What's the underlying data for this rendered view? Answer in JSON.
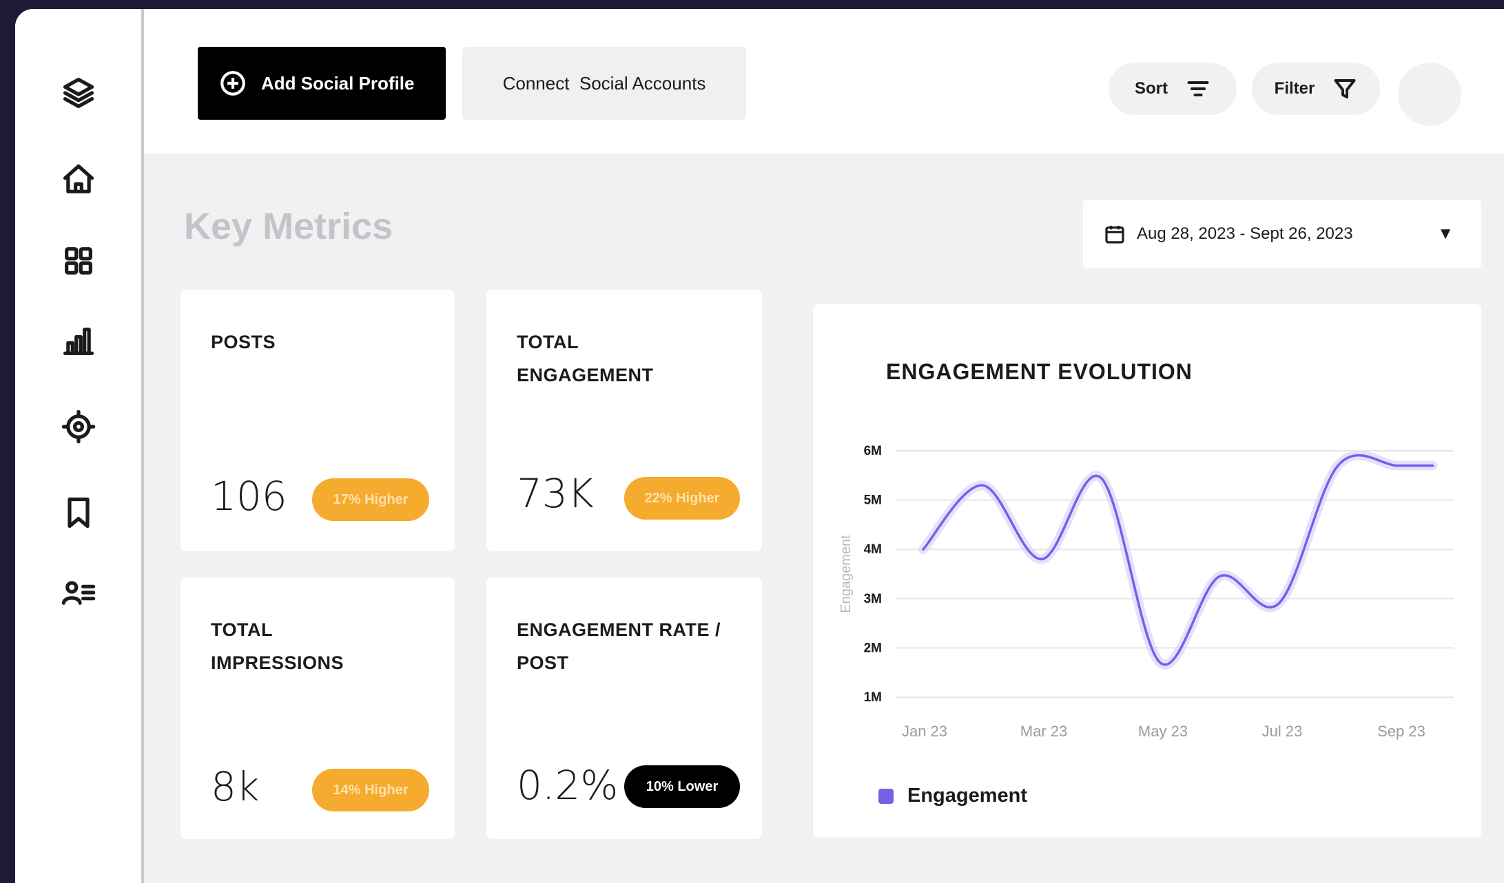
{
  "toolbar": {
    "add_profile_label": "Add Social Profile",
    "connect_label": "Connect  Social Accounts",
    "sort_label": "Sort",
    "filter_label": "Filter"
  },
  "sidebar": {
    "items": [
      {
        "icon": "layers-icon"
      },
      {
        "icon": "home-icon"
      },
      {
        "icon": "grid-icon"
      },
      {
        "icon": "bar-chart-icon"
      },
      {
        "icon": "target-icon"
      },
      {
        "icon": "bookmark-icon"
      },
      {
        "icon": "user-list-icon"
      }
    ]
  },
  "main": {
    "title": "Key Metrics",
    "date_range": "Aug 28, 2023 - Sept 26, 2023",
    "metrics": [
      {
        "label": "POSTS",
        "value": "106",
        "badge": "17% Higher",
        "trend": "up"
      },
      {
        "label": "TOTAL ENGAGEMENT",
        "value": "73K",
        "badge": "22% Higher",
        "trend": "up"
      },
      {
        "label": "TOTAL IMPRESSIONS",
        "value": "8k",
        "badge": "14% Higher",
        "trend": "up"
      },
      {
        "label": "ENGAGEMENT RATE / POST",
        "value": "0.2%",
        "badge": "10% Lower",
        "trend": "down"
      }
    ]
  },
  "colors": {
    "accent": "#7461e8",
    "badge_up": "#f5ab2e",
    "badge_down": "#000000"
  },
  "chart_data": {
    "type": "line",
    "title": "ENGAGEMENT EVOLUTION",
    "ylabel": "Engagement",
    "xlabel": "",
    "x_ticks": [
      "Jan 23",
      "Mar 23",
      "May 23",
      "Jul 23",
      "Sep 23"
    ],
    "y_ticks": [
      "1M",
      "2M",
      "3M",
      "4M",
      "5M",
      "6M"
    ],
    "ylim": [
      1,
      6
    ],
    "grid": true,
    "legend_position": "bottom-left",
    "series": [
      {
        "name": "Engagement",
        "x": [
          0.0,
          1.0,
          2.0,
          3.0,
          4.0,
          5.0,
          6.0,
          7.0,
          8.0,
          8.6
        ],
        "values": [
          4.0,
          5.3,
          3.8,
          5.45,
          1.7,
          3.45,
          2.9,
          5.7,
          5.7,
          5.7
        ]
      }
    ]
  }
}
